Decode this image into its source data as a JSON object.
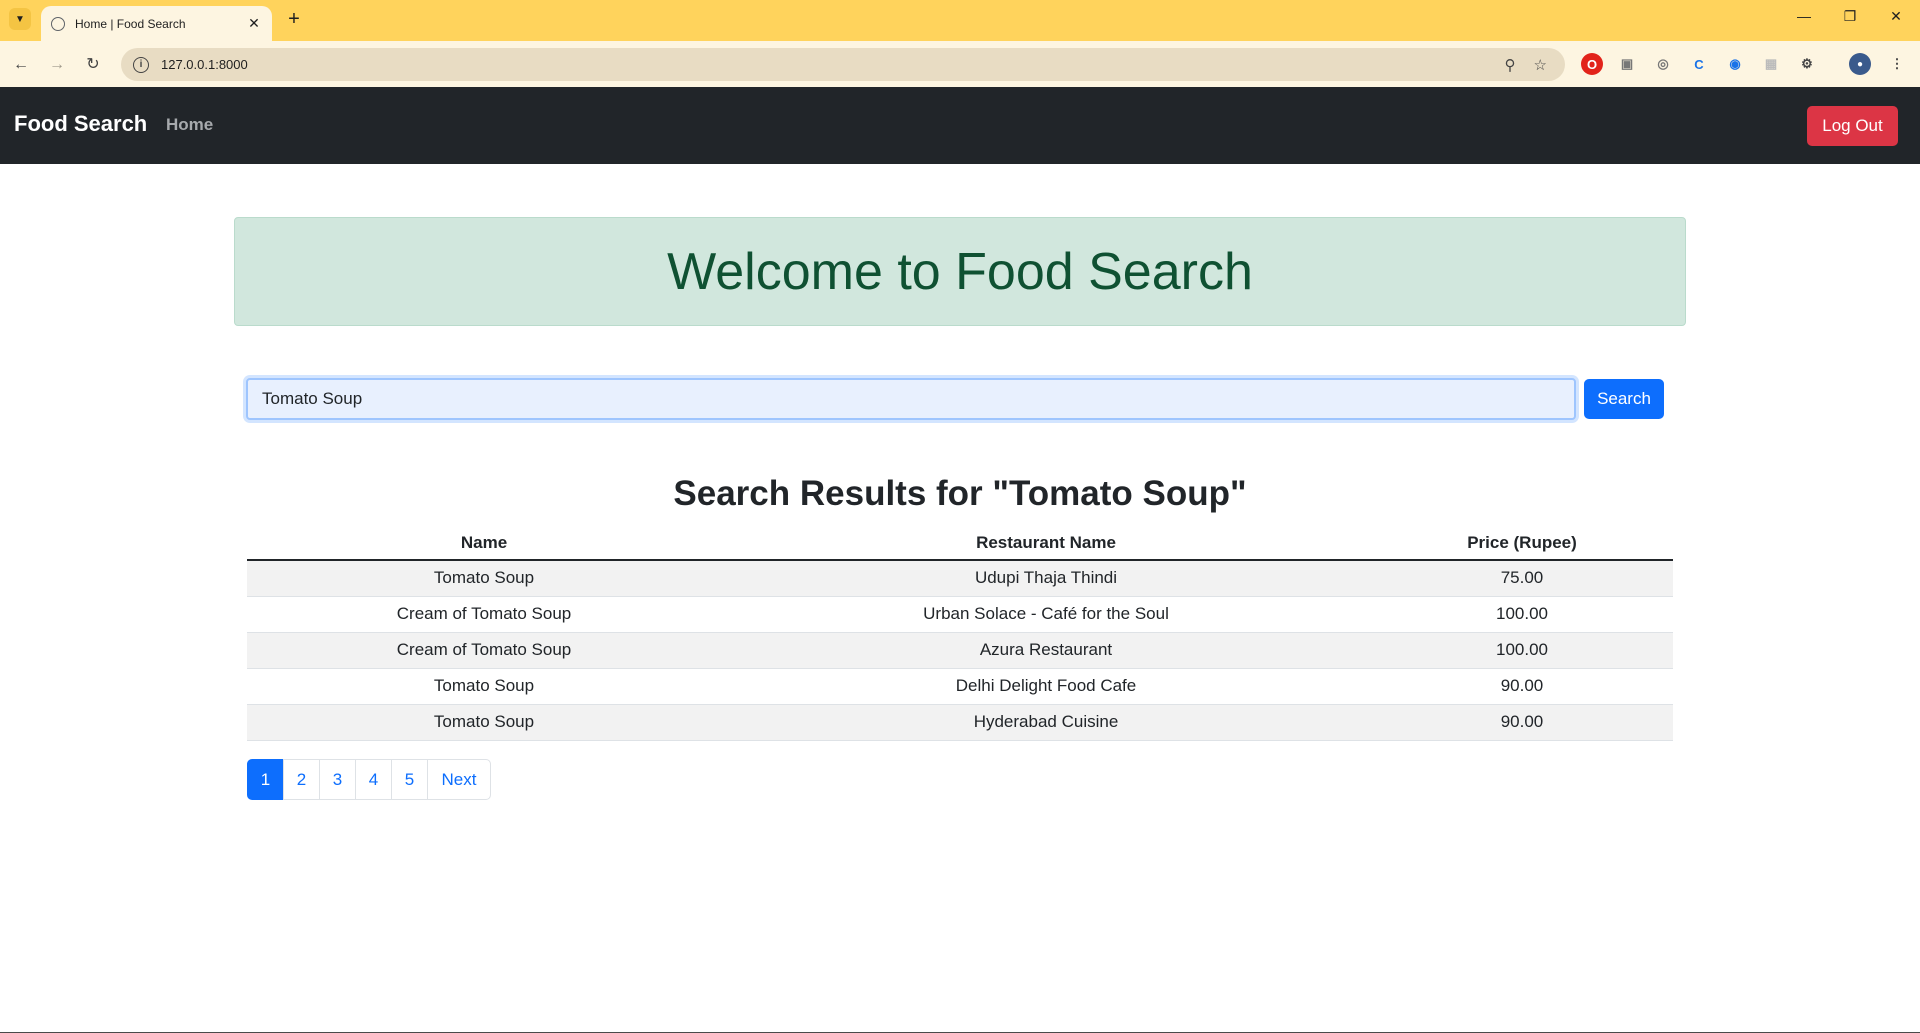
{
  "browser": {
    "tab_title": "Home | Food Search",
    "url": "127.0.0.1:8000"
  },
  "navbar": {
    "brand": "Food Search",
    "home_link": "Home",
    "logout_label": "Log Out"
  },
  "banner": {
    "heading": "Welcome to Food Search"
  },
  "search": {
    "value": "Tomato Soup",
    "button_label": "Search"
  },
  "results": {
    "title": "Search Results for \"Tomato Soup\"",
    "columns": [
      "Name",
      "Restaurant Name",
      "Price (Rupee)"
    ],
    "rows": [
      {
        "name": "Tomato Soup",
        "restaurant": "Udupi Thaja Thindi",
        "price": "75.00"
      },
      {
        "name": "Cream of Tomato Soup",
        "restaurant": "Urban Solace - Café for the Soul",
        "price": "100.00"
      },
      {
        "name": "Cream of Tomato Soup",
        "restaurant": "Azura Restaurant",
        "price": "100.00"
      },
      {
        "name": "Tomato Soup",
        "restaurant": "Delhi Delight Food Cafe",
        "price": "90.00"
      },
      {
        "name": "Tomato Soup",
        "restaurant": "Hyderabad Cuisine",
        "price": "90.00"
      }
    ]
  },
  "pagination": {
    "pages": [
      "1",
      "2",
      "3",
      "4",
      "5"
    ],
    "current": "1",
    "next_label": "Next"
  },
  "colors": {
    "navbar_bg": "#212529",
    "logout_red": "#dc3545",
    "primary_blue": "#0d6efd",
    "banner_green": "#d1e7dd",
    "banner_text": "#0f5132",
    "chrome_yellow": "#ffd35c"
  }
}
